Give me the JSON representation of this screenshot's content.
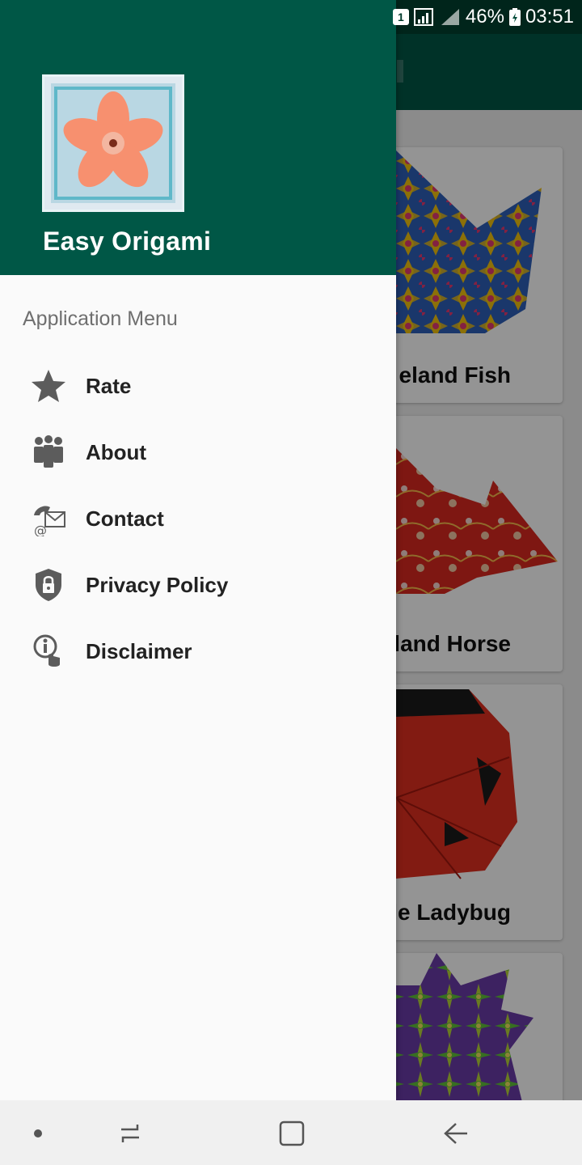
{
  "status_bar": {
    "sim_badge": "1",
    "battery_percent": "46%",
    "time": "03:51"
  },
  "drawer": {
    "app_name": "Easy Origami",
    "section_title": "Application Menu",
    "items": [
      {
        "label": "Rate",
        "icon": "star-icon"
      },
      {
        "label": "About",
        "icon": "people-icon"
      },
      {
        "label": "Contact",
        "icon": "contact-phone-mail-icon"
      },
      {
        "label": "Privacy Policy",
        "icon": "shield-lock-icon"
      },
      {
        "label": "Disclaimer",
        "icon": "info-touch-icon"
      }
    ]
  },
  "background_list": {
    "cards": [
      {
        "title": "eland Fish"
      },
      {
        "title": "land Horse"
      },
      {
        "title": "ole Ladybug"
      },
      {
        "title": ""
      }
    ]
  },
  "navigation_bar": {
    "buttons": [
      "dot-icon",
      "recents-icon",
      "home-icon",
      "back-icon"
    ]
  },
  "colors": {
    "header": "#005746",
    "status_bar": "#00412f",
    "drawer_bg": "#fafafa"
  }
}
